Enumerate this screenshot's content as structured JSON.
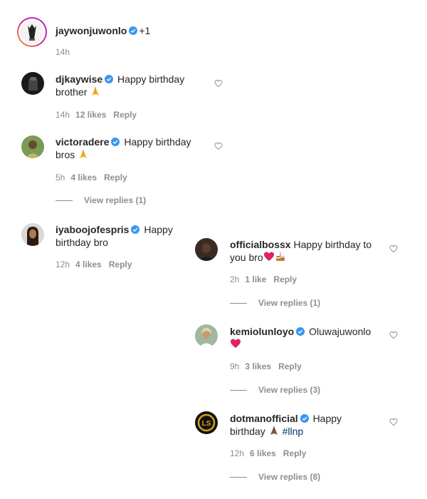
{
  "post": {
    "username": "jaywonjuwonlo",
    "plus": "+1",
    "time": "14h"
  },
  "comments": [
    {
      "username": "djkaywise",
      "text_line1": "Happy birthday",
      "text_line2": "brother",
      "emoji": "folded-hands",
      "time": "14h",
      "likes": "12 likes",
      "reply": "Reply"
    },
    {
      "username": "victoradere",
      "text_line1": "Happy birthday",
      "text_line2": "bros",
      "emoji": "folded-hands",
      "time": "5h",
      "likes": "4 likes",
      "reply": "Reply",
      "view_replies": "View replies (1)"
    },
    {
      "username": "iyaboojofespris",
      "text_line1": "Happy",
      "text_line2": "birthday bro",
      "time": "12h",
      "likes": "4 likes",
      "reply": "Reply"
    }
  ],
  "replies": [
    {
      "username": "officialbossx",
      "text_line1": "Happy birthday to",
      "text_line2": "you bro",
      "emoji": "heart-and-cake",
      "time": "2h",
      "likes": "1 like",
      "reply": "Reply",
      "view_replies": "View replies (1)"
    },
    {
      "username": "kemiolunloyo",
      "text_line1": "Oluwajuwonlo",
      "emoji": "red-heart",
      "time": "9h",
      "likes": "3 likes",
      "reply": "Reply",
      "view_replies": "View replies (3)"
    },
    {
      "username": "dotmanofficial",
      "text_line1": "Happy",
      "text_line2": "birthday",
      "hashtag": "#llnp",
      "emoji": "folded-hands",
      "time": "12h",
      "likes": "6 likes",
      "reply": "Reply",
      "view_replies": "View replies (8)"
    }
  ],
  "colors": {
    "verified": "#3897f0",
    "story_ring": "#d6249f",
    "meta_gray": "#8e8e8e",
    "heart_red": "#e0245e",
    "hashtag": "#00376b"
  }
}
